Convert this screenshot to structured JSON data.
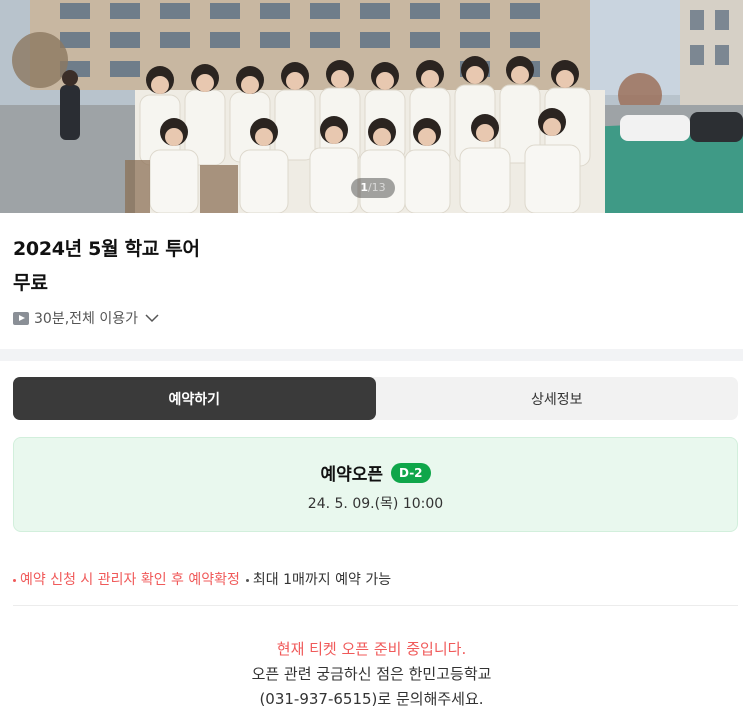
{
  "hero": {
    "image_alt": "school students group photo",
    "page_current": "1",
    "page_total": "/13"
  },
  "event": {
    "title": "2024년 5월 학교 투어",
    "price": "무료",
    "meta": "30분,전체 이용가"
  },
  "tabs": [
    {
      "label": "예약하기",
      "active": true
    },
    {
      "label": "상세정보",
      "active": false
    }
  ],
  "reservation": {
    "title": "예약오픈",
    "dday": "D-2",
    "date": "24. 5. 09.(목) 10:00"
  },
  "notes": {
    "primary": "예약 신청 시 관리자 확인 후 예약확정",
    "secondary": "최대 1매까지 예약 가능"
  },
  "notice": {
    "line1": "현재 티켓 오픈 준비 중입니다.",
    "line2": "오픈 관련 궁금하신 점은 한민고등학교",
    "line3": "(031-937-6515)로 문의해주세요."
  },
  "colors": {
    "accent_green": "#0fa64a",
    "card_bg": "#e9f8ee",
    "alert_red": "#f05a5a",
    "active_tab": "#3a3a3a"
  }
}
